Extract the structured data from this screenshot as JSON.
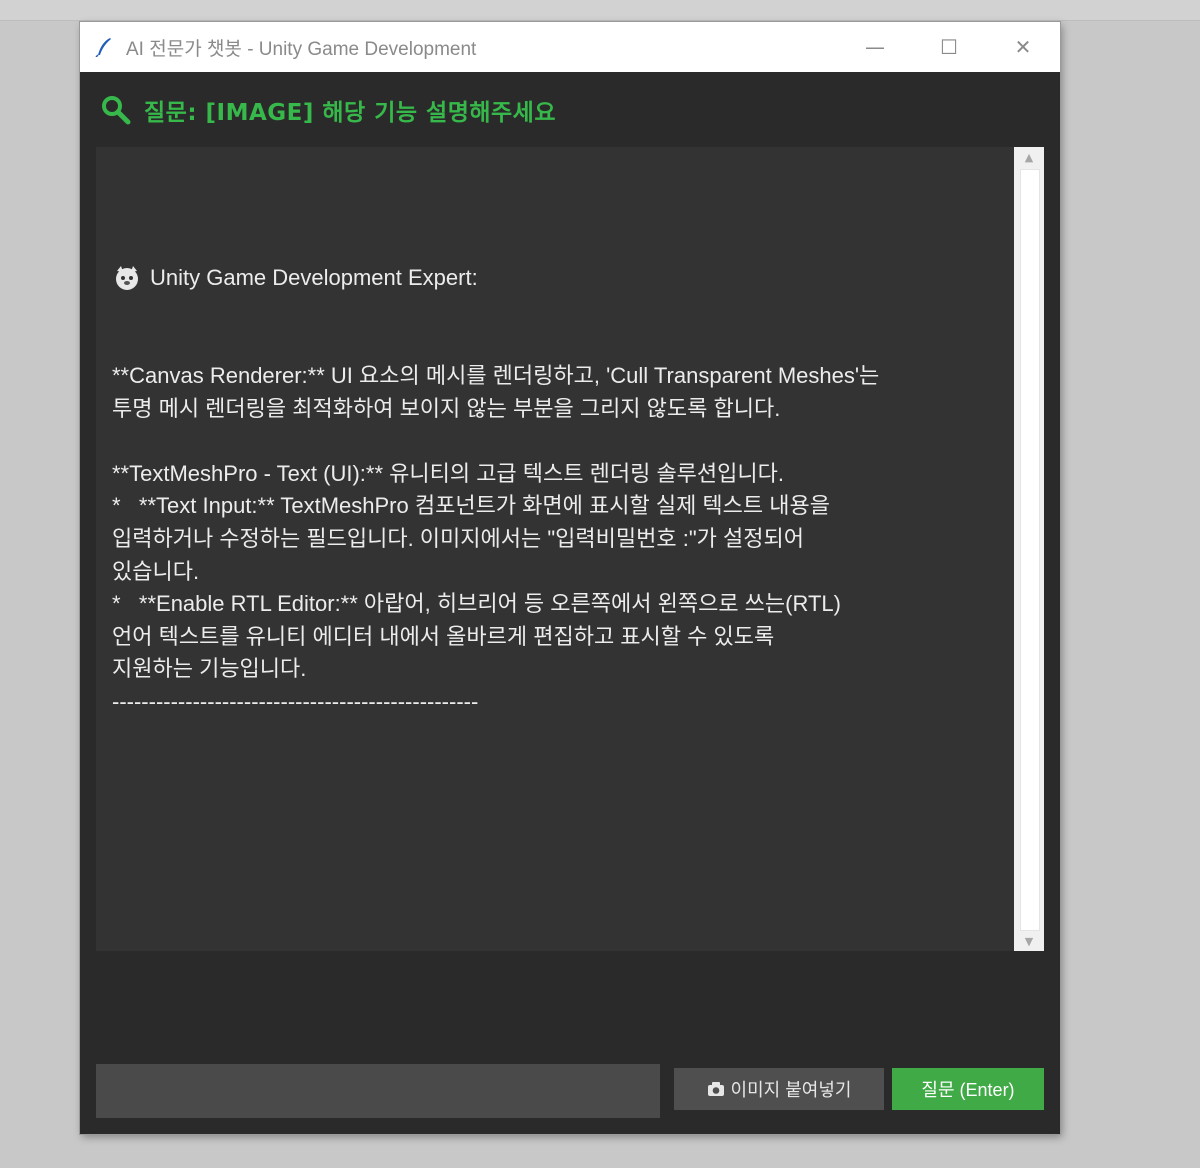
{
  "window": {
    "title": "AI 전문가 챗봇 - Unity Game Development",
    "icons": {
      "app": "feather-pen-icon",
      "minimize": "minimize-icon",
      "maximize": "maximize-icon",
      "close": "close-icon"
    },
    "controls": {
      "minimize": "—",
      "maximize": "☐",
      "close": "✕"
    }
  },
  "question": {
    "icon": "magnifier-icon",
    "text": "질문: [IMAGE] 해당 기능 설명해주세요"
  },
  "answer": {
    "icon": "bot-icon",
    "header": "Unity Game Development Expert:",
    "body": "**Canvas Renderer:** UI 요소의 메시를 렌더링하고, 'Cull Transparent Meshes'는\n투명 메시 렌더링을 최적화하여 보이지 않는 부분을 그리지 않도록 합니다.\n\n**TextMeshPro - Text (UI):** 유니티의 고급 텍스트 렌더링 솔루션입니다.\n*   **Text Input:** TextMeshPro 컴포넌트가 화면에 표시할 실제 텍스트 내용을\n입력하거나 수정하는 필드입니다. 이미지에서는 \"입력비밀번호 :\"가 설정되어\n있습니다.\n*   **Enable RTL Editor:** 아랍어, 히브리어 등 오른쪽에서 왼쪽으로 쓰는(RTL)\n언어 텍스트를 유니티 에디터 내에서 올바르게 편집하고 표시할 수 있도록\n지원하는 기능입니다.\n--------------------------------------------------"
  },
  "scrollbar": {
    "up": "▲",
    "down": "▼"
  },
  "input": {
    "value": "",
    "placeholder": ""
  },
  "buttons": {
    "paste_image": {
      "icon": "camera-icon",
      "label": "이미지 붙여넣기"
    },
    "ask": {
      "label": "질문 (Enter)"
    }
  },
  "colors": {
    "accent": "#37b84a",
    "background": "#2a2a2a",
    "panel": "#333333",
    "button": "#4f4f4f"
  }
}
